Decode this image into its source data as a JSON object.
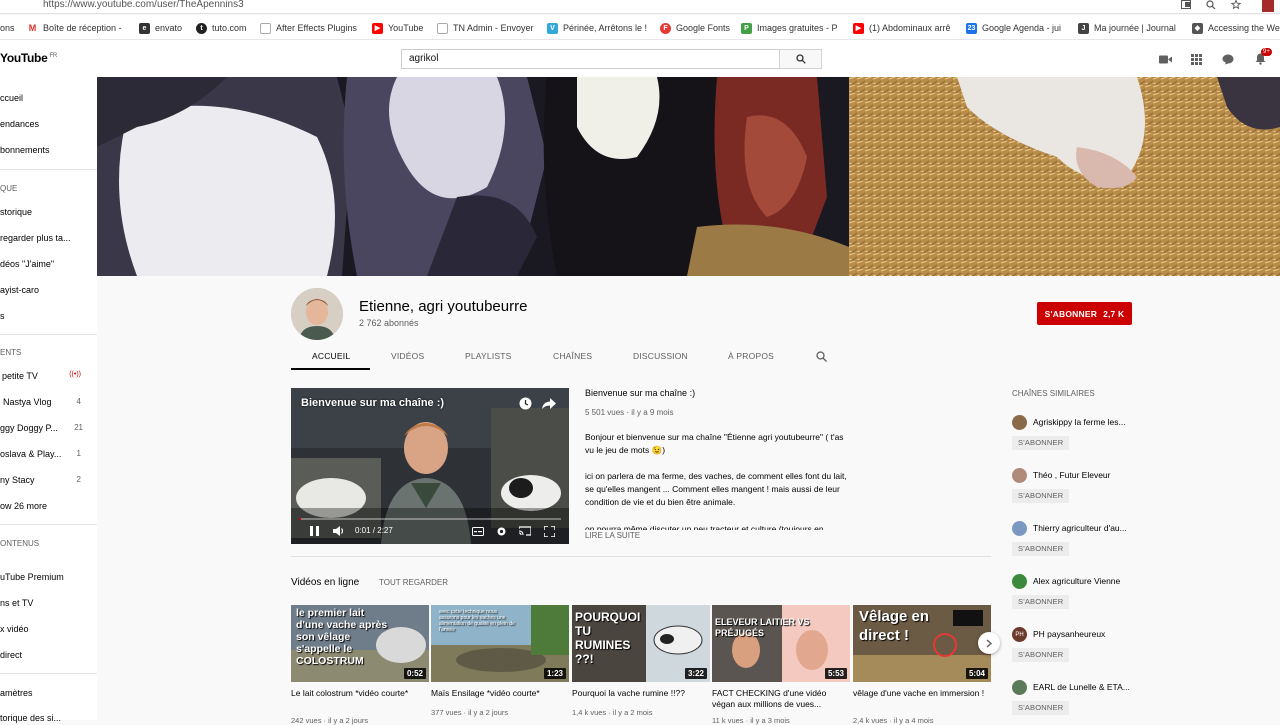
{
  "browser": {
    "url": "https://www.youtube.com/user/TheApennins3",
    "bookmarks": [
      {
        "label": "ons",
        "icon": "apps-icon",
        "color": "#4285f4"
      },
      {
        "label": "Boîte de réception -",
        "icon": "gmail-icon",
        "color": "#d93025"
      },
      {
        "label": "envato",
        "icon": "envato-icon",
        "color": "#333333"
      },
      {
        "label": "tuto.com",
        "icon": "tuto-icon",
        "color": "#222222"
      },
      {
        "label": "After Effects Plugins",
        "icon": "document-icon",
        "color": "#9e9e9e"
      },
      {
        "label": "YouTube",
        "icon": "youtube-icon",
        "color": "#ff0000"
      },
      {
        "label": "TN Admin - Envoyer",
        "icon": "document-icon",
        "color": "#9e9e9e"
      },
      {
        "label": "Périnée, Arrêtons le !",
        "icon": "v-icon",
        "color": "#31a8d8"
      },
      {
        "label": "Google Fonts",
        "icon": "fonts-icon",
        "color": "#e53935"
      },
      {
        "label": "Images gratuites - P",
        "icon": "px-icon",
        "color": "#43a047"
      },
      {
        "label": "(1) Abdominaux arrê",
        "icon": "youtube-icon",
        "color": "#ff0000"
      },
      {
        "label": "Google Agenda - jui",
        "icon": "calendar-icon",
        "color": "#1a73e8"
      },
      {
        "label": "Ma journée | Journal",
        "icon": "journal-icon",
        "color": "#444444"
      },
      {
        "label": "Accessing the Web",
        "icon": "web-icon",
        "color": "#555555"
      }
    ]
  },
  "header": {
    "logo_text": "YouTube",
    "logo_region": "FR",
    "search_value": "agrikol",
    "notification_count": "9+"
  },
  "sidebar": {
    "items_top": [
      {
        "label": "ccueil"
      },
      {
        "label": "endances"
      },
      {
        "label": "bonnements"
      }
    ],
    "library_heading": "QUE",
    "library_items": [
      {
        "label": "storique"
      },
      {
        "label": "regarder plus ta..."
      },
      {
        "label": "déos \"J'aime\""
      },
      {
        "label": "ayist-caro"
      },
      {
        "label": "s"
      }
    ],
    "subs_heading": "ENTS",
    "subscriptions": [
      {
        "label": "petite TV",
        "count": "((•))"
      },
      {
        "label": "Nastya Vlog",
        "count": "4"
      },
      {
        "label": "ggy Doggy P...",
        "count": "21"
      },
      {
        "label": "oslava & Play...",
        "count": "1"
      },
      {
        "label": "ny Stacy",
        "count": "2"
      },
      {
        "label": "ow 26 more",
        "count": ""
      }
    ],
    "more_heading": "ONTENUS",
    "more_items": [
      {
        "label": "uTube Premium"
      },
      {
        "label": "ns et TV"
      },
      {
        "label": "x vidéo"
      },
      {
        "label": "direct"
      }
    ],
    "settings_items": [
      {
        "label": "amètres"
      },
      {
        "label": "torique des si..."
      }
    ]
  },
  "channel": {
    "name": "Etienne, agri youtubeurre",
    "subscribers": "2 762 abonnés",
    "subscribe_label": "S'ABONNER",
    "subscribe_count": "2,7 K",
    "tabs": [
      "ACCUEIL",
      "VIDÉOS",
      "PLAYLISTS",
      "CHAÎNES",
      "DISCUSSION",
      "À PROPOS"
    ]
  },
  "featured": {
    "player_title": "Bienvenue sur ma chaîne :)",
    "time": "0:01 / 2:27",
    "progress": 0.007,
    "title": "Bienvenue sur ma chaîne :)",
    "meta": "5 501 vues · il y a 9 mois",
    "paragraph1": "Bonjour et bienvenue sur ma chaîne \"Étienne agri youtubeurre\" ( t'as vu le jeu de mots 😉)",
    "paragraph2": "ici on parlera de ma ferme, des vaches, de comment elles font du lait, se qu'elles mangent ... Comment elles mangent ! mais aussi de leur condition de vie et du bien être animale.",
    "paragraph3": "on pourra même discuter un peu tracteur et culture (toujours en",
    "read_more": "LIRE LA SUITE"
  },
  "uploads": {
    "title": "Vidéos en ligne",
    "play_all": "TOUT REGARDER",
    "videos": [
      {
        "title": "Le lait colostrum *vidéo courte*",
        "meta": "242 vues · il y a 2 jours",
        "duration": "0:52",
        "thumb_text": "le premier lait d'une vache après son vêlage s'appelle le COLOSTRUM"
      },
      {
        "title": "Maïs Ensilage *vidéo courte*",
        "meta": "377 vues · il y a 2 jours",
        "duration": "1:23",
        "thumb_text": "avec cette technique nous assurons pour les vaches une alimentation de qualité en plein de l'année"
      },
      {
        "title": "Pourquoi la vache rumine !!??",
        "meta": "1,4 k vues · il y a 2 mois",
        "duration": "3:22",
        "thumb_text": "POURQUOI TU RUMINES ??!"
      },
      {
        "title": "FACT CHECKING d'une vidéo végan aux millions de vues...",
        "meta": "11 k vues · il y a 3 mois",
        "duration": "5:53",
        "thumb_text": "ELEVEUR LAITIER VS PRÉJUGÉS"
      },
      {
        "title": "vêlage d'une vache en immersion !",
        "meta": "2,4 k vues · il y a 4 mois",
        "duration": "5:04",
        "thumb_text": "Vêlage en direct !"
      }
    ]
  },
  "related": {
    "title": "CHAÎNES SIMILAIRES",
    "button_label": "S'ABONNER",
    "channels": [
      {
        "name": "Agriskippy la ferme les...",
        "color": "#8a6a4a"
      },
      {
        "name": "Théo , Futur Eleveur",
        "color": "#b08a7a"
      },
      {
        "name": "Thierry agriculteur d'au...",
        "color": "#7a98c0"
      },
      {
        "name": "Alex agriculture Vienne",
        "color": "#3b8a3b"
      },
      {
        "name": "PH paysanheureux",
        "color": "#6b3a2a",
        "initials": "PH"
      },
      {
        "name": "EARL de Lunelle & ETA...",
        "color": "#5a7a5a"
      }
    ]
  }
}
